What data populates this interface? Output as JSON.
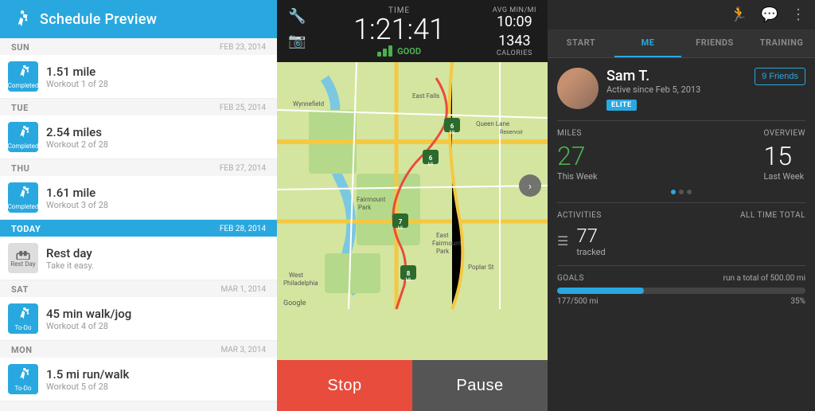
{
  "schedule": {
    "title": "Schedule Preview",
    "days": [
      {
        "day": "SUN",
        "date": "FEB 23, 2014",
        "type": "workout",
        "status": "completed",
        "title": "1.51 mile",
        "subtitle": "Workout 1 of 28"
      },
      {
        "day": "TUE",
        "date": "FEB 25, 2014",
        "type": "workout",
        "status": "completed",
        "title": "2.54 miles",
        "subtitle": "Workout 2 of 28"
      },
      {
        "day": "THU",
        "date": "FEB 27, 2014",
        "type": "workout",
        "status": "completed",
        "title": "1.61 mile",
        "subtitle": "Workout 3 of 28"
      },
      {
        "day": "TODAY",
        "date": "FEB 28, 2014",
        "type": "rest",
        "status": "rest",
        "title": "Rest day",
        "subtitle": "Take it easy."
      },
      {
        "day": "SAT",
        "date": "MAR 1, 2014",
        "type": "workout",
        "status": "todo",
        "title": "45 min walk/jog",
        "subtitle": "Workout 4 of 28"
      },
      {
        "day": "MON",
        "date": "MAR 3, 2014",
        "type": "workout",
        "status": "todo",
        "title": "1.5 mi run/walk",
        "subtitle": "Workout 5 of 28"
      }
    ]
  },
  "tracker": {
    "time_label": "TIME",
    "time_value": "1:21:41",
    "signal_label": "GOOD",
    "avg_pace_label": "AVG MIN/MI",
    "avg_pace_value": "10:09",
    "calories_value": "1343",
    "calories_label": "CALORIES",
    "stop_label": "Stop",
    "pause_label": "Pause",
    "waypoints": [
      "6 Mi",
      "6 Mi",
      "7 Mi",
      "8 Mi"
    ]
  },
  "profile": {
    "tabs": [
      "START",
      "ME",
      "FRIENDS",
      "TRAINING"
    ],
    "active_tab": "ME",
    "user": {
      "name": "Sam T.",
      "since": "Active since Feb 5, 2013",
      "badge": "ELITE",
      "friends_count": "9 Friends"
    },
    "miles": {
      "label": "MILES",
      "this_week_label": "This Week",
      "this_week_value": "27",
      "overview_label": "OVERVIEW",
      "last_week_label": "Last Week",
      "last_week_value": "15"
    },
    "activities": {
      "label": "ACTIVITIES",
      "all_time_label": "All Time Total",
      "count": "77",
      "sub_label": "tracked"
    },
    "goals": {
      "label": "GOALS",
      "description": "run a total of 500.00 mi",
      "progress_text": "177/500 mi",
      "progress_pct": "35%",
      "progress_value": 35
    }
  }
}
